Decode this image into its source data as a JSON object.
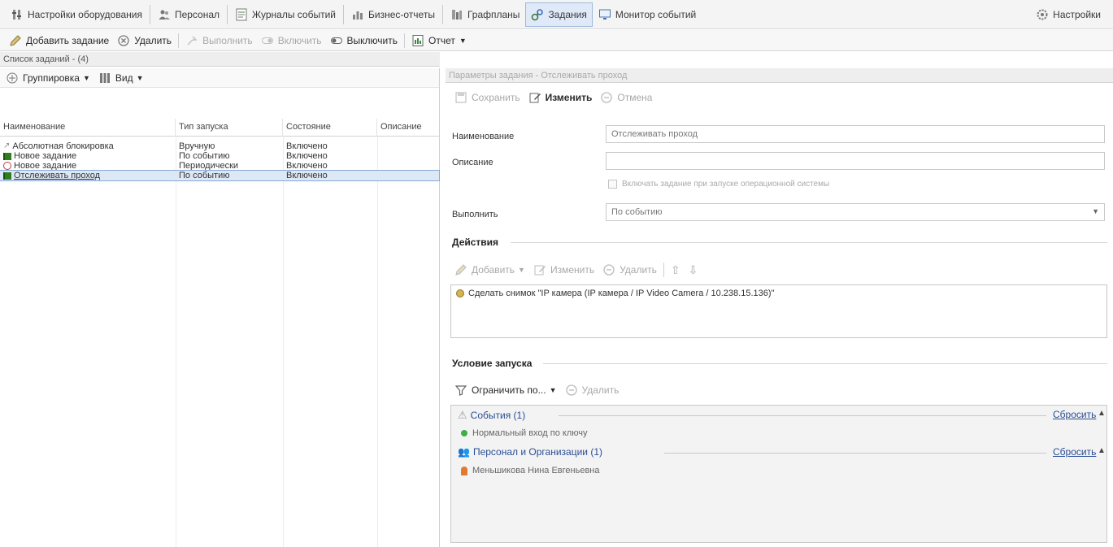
{
  "nav": {
    "items": [
      {
        "label": "Настройки оборудования",
        "icon": "hardware-settings-icon"
      },
      {
        "label": "Персонал",
        "icon": "personnel-icon"
      },
      {
        "label": "Журналы событий",
        "icon": "event-log-icon"
      },
      {
        "label": "Бизнес-отчеты",
        "icon": "business-report-icon"
      },
      {
        "label": "Графпланы",
        "icon": "floorplan-icon"
      },
      {
        "label": "Задания",
        "icon": "tasks-icon",
        "active": true
      },
      {
        "label": "Монитор событий",
        "icon": "event-monitor-icon"
      }
    ],
    "settings_label": "Настройки"
  },
  "toolbar": {
    "add_task": "Добавить задание",
    "delete": "Удалить",
    "execute": "Выполнить",
    "enable": "Включить",
    "disable": "Выключить",
    "report": "Отчет"
  },
  "task_list": {
    "header": "Список заданий - (4)",
    "grouping_label": "Группировка",
    "view_label": "Вид",
    "columns": [
      "Наименование",
      "Тип запуска",
      "Состояние",
      "Описание"
    ],
    "rows": [
      {
        "name": "Абсолютная блокировка",
        "launch": "Вручную",
        "state": "Включено",
        "description": "",
        "icon": "manual-icon"
      },
      {
        "name": "Новое задание",
        "launch": "По событию",
        "state": "Включено",
        "description": "",
        "icon": "flag-icon"
      },
      {
        "name": "Новое задание",
        "launch": "Периодически",
        "state": "Включено",
        "description": "",
        "icon": "clock-icon"
      },
      {
        "name": "Отслеживать проход",
        "launch": "По событию",
        "state": "Включено",
        "description": "",
        "icon": "flag-icon",
        "selected": true
      }
    ]
  },
  "task_params": {
    "header": "Параметры задания - Отслеживать проход",
    "save": "Сохранить",
    "edit": "Изменить",
    "cancel": "Отмена",
    "name_label": "Наименование",
    "name_value": "Отслеживать проход",
    "description_label": "Описание",
    "description_value": "",
    "os_start_checkbox": "Включать задание при запуске операционной системы",
    "execute_label": "Выполнить",
    "execute_value": "По событию"
  },
  "actions": {
    "title": "Действия",
    "add": "Добавить",
    "edit": "Изменить",
    "delete": "Удалить",
    "items": [
      "Сделать снимок \"IP камера (IP камера / IP Video Camera / 10.238.15.136)\""
    ]
  },
  "launch_condition": {
    "title": "Условие запуска",
    "restrict": "Ограничить по...",
    "delete": "Удалить",
    "reset": "Сбросить",
    "groups": [
      {
        "title": "События (1)",
        "icon": "warning-icon",
        "item": "Нормальный вход по ключу",
        "item_icon": "green-dot-icon"
      },
      {
        "title": "Персонал и Организации (1)",
        "icon": "personnel-icon",
        "item": "Меньшикова Нина Евгеньевна",
        "item_icon": "person-icon"
      }
    ]
  },
  "colors": {
    "accent": "#2a4e94",
    "selection": "#dde8f6",
    "flag": "#2e7d1f",
    "green_dot": "#3cb043"
  }
}
